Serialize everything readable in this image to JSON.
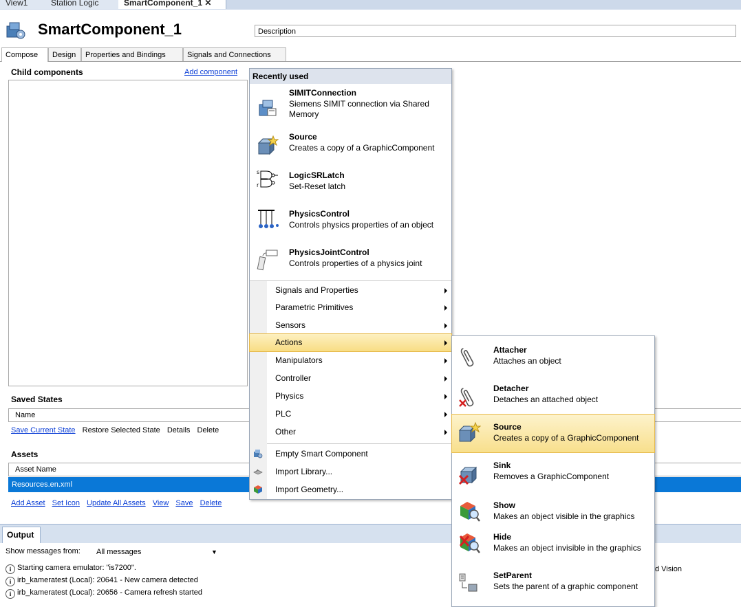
{
  "doc_tabs": [
    "View1",
    "Station Logic",
    "SmartComponent_1"
  ],
  "header": {
    "title": "SmartComponent_1",
    "description": "Description"
  },
  "compose_tabs": [
    "Compose",
    "Design",
    "Properties and Bindings",
    "Signals and Connections"
  ],
  "child_components": {
    "label": "Child components",
    "add_link": "Add component"
  },
  "saved_states": {
    "label": "Saved States",
    "column": "Name",
    "actions": [
      "Save Current State",
      "Restore Selected State",
      "Details",
      "Delete"
    ]
  },
  "assets": {
    "label": "Assets",
    "column": "Asset Name",
    "row": "Resources.en.xml",
    "actions": [
      "Add Asset",
      "Set Icon",
      "Update All Assets",
      "View",
      "Save",
      "Delete"
    ]
  },
  "output": {
    "tab": "Output",
    "filter_label": "Show messages from:",
    "filter_value": "All messages",
    "messages": [
      "Starting camera emulator: \"is7200\".",
      "irb_kameratest (Local): 20641 - New camera detected",
      "irb_kameratest (Local): 20656 - Camera refresh started"
    ],
    "right_fragment": "d Vision"
  },
  "menu": {
    "recent_header": "Recently used",
    "recent": [
      {
        "name": "SIMITConnection",
        "desc": "Siemens SIMIT connection via Shared Memory",
        "icon": "simit-icon"
      },
      {
        "name": "Source",
        "desc": "Creates a copy of a GraphicComponent",
        "icon": "source-icon"
      },
      {
        "name": "LogicSRLatch",
        "desc": "Set-Reset latch",
        "icon": "srlatch-icon"
      },
      {
        "name": "PhysicsControl",
        "desc": "Controls physics properties of an object",
        "icon": "physics-control-icon"
      },
      {
        "name": "PhysicsJointControl",
        "desc": "Controls properties of a physics joint",
        "icon": "physics-joint-icon"
      }
    ],
    "submenus": [
      "Signals and Properties",
      "Parametric Primitives",
      "Sensors",
      "Actions",
      "Manipulators",
      "Controller",
      "Physics",
      "PLC",
      "Other"
    ],
    "bottom": [
      {
        "label": "Empty Smart Component",
        "icon": "smart-component-icon"
      },
      {
        "label": "Import Library...",
        "icon": "library-icon"
      },
      {
        "label": "Import Geometry...",
        "icon": "geometry-icon"
      }
    ]
  },
  "actions_submenu": [
    {
      "name": "Attacher",
      "desc": "Attaches an object",
      "icon": "paperclip-icon"
    },
    {
      "name": "Detacher",
      "desc": "Detaches an attached object",
      "icon": "paperclip-remove-icon"
    },
    {
      "name": "Source",
      "desc": "Creates a copy of a GraphicComponent",
      "icon": "source-icon"
    },
    {
      "name": "Sink",
      "desc": "Removes a GraphicComponent",
      "icon": "sink-icon"
    },
    {
      "name": "Show",
      "desc": "Makes an object visible in the graphics",
      "icon": "show-icon"
    },
    {
      "name": "Hide",
      "desc": "Makes an object invisible in the graphics",
      "icon": "hide-icon"
    },
    {
      "name": "SetParent",
      "desc": "Sets the parent of a graphic component",
      "icon": "set-parent-icon"
    }
  ],
  "colors": {
    "selection": "#0a78d7",
    "highlight": "#f8dd84",
    "link": "#0b3ed6"
  }
}
